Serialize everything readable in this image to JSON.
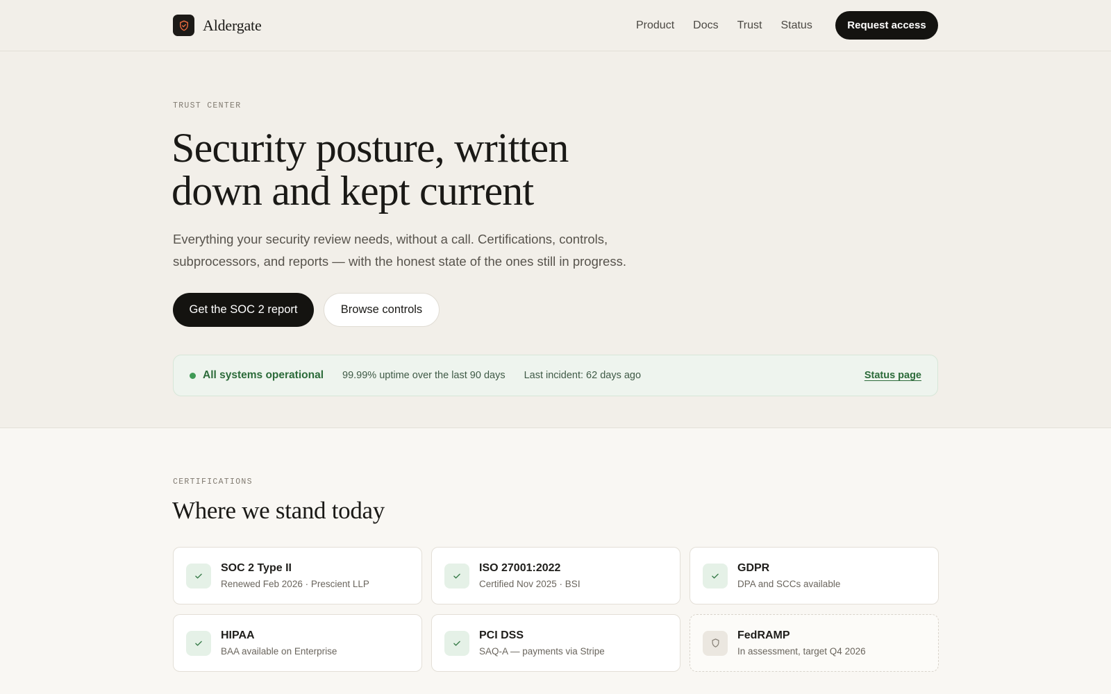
{
  "header": {
    "brand_name": "Aldergate",
    "nav": [
      "Product",
      "Docs",
      "Trust",
      "Status"
    ],
    "cta_label": "Request access"
  },
  "hero": {
    "eyebrow": "TRUST CENTER",
    "title_line1": "Security posture, written",
    "title_line2": "down and kept current",
    "subtitle": "Everything your security review needs, without a call. Certifications, controls, subprocessors, and reports — with the honest state of the ones still in progress.",
    "primary_cta": "Get the SOC 2 report",
    "secondary_cta": "Browse controls"
  },
  "status": {
    "state": "All systems operational",
    "uptime": "99.99% uptime over the last 90 days",
    "last_incident": "Last incident: 62 days ago",
    "link_label": "Status page",
    "color": "#3f9a55"
  },
  "certifications": {
    "eyebrow": "CERTIFICATIONS",
    "title": "Where we stand today",
    "items": [
      {
        "name": "SOC 2 Type II",
        "detail": "Renewed Feb 2026 · Prescient LLP",
        "icon": "check-icon"
      },
      {
        "name": "ISO 27001:2022",
        "detail": "Certified Nov 2025 · BSI",
        "icon": "check-icon"
      },
      {
        "name": "GDPR",
        "detail": "DPA and SCCs available",
        "icon": "check-icon"
      },
      {
        "name": "HIPAA",
        "detail": "BAA available on Enterprise",
        "icon": "check-icon"
      },
      {
        "name": "PCI DSS",
        "detail": "SAQ-A — payments via Stripe",
        "icon": "check-icon"
      },
      {
        "name": "FedRAMP",
        "detail": "In assessment, target Q4 2026",
        "icon": "shield-icon"
      }
    ]
  },
  "colors": {
    "ink": "#141310",
    "background": "#f2efe9",
    "success": "#3f9a55",
    "brand_accent": "#e0673e"
  }
}
